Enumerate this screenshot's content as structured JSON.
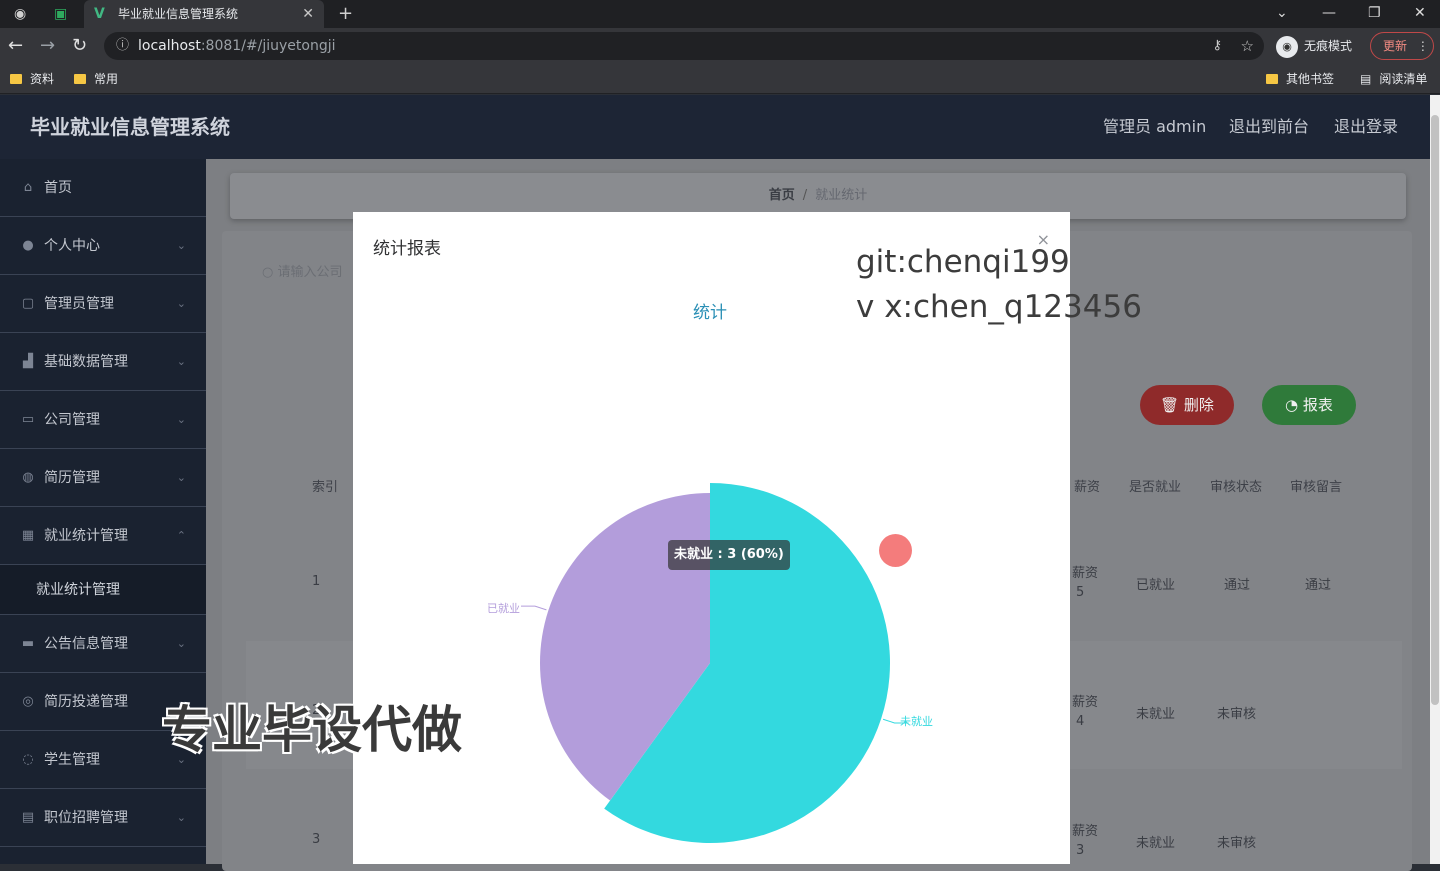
{
  "browser": {
    "tab_title": "毕业就业信息管理系统",
    "url_host": "localhost",
    "url_rest": ":8081/#/jiuyetongji",
    "incognito_label": "无痕模式",
    "update_label": "更新",
    "bookmarks": [
      "资料",
      "常用"
    ],
    "other_bookmarks": "其他书签",
    "reading_list": "阅读清单"
  },
  "app": {
    "brand": "毕业就业信息管理系统",
    "top_links": [
      "管理员 admin",
      "退出到前台",
      "退出登录"
    ]
  },
  "sidebar": {
    "items": [
      {
        "label": "首页",
        "icon": "home-icon"
      },
      {
        "label": "个人中心",
        "icon": "user-icon"
      },
      {
        "label": "管理员管理",
        "icon": "admin-icon"
      },
      {
        "label": "基础数据管理",
        "icon": "data-icon"
      },
      {
        "label": "公司管理",
        "icon": "company-icon"
      },
      {
        "label": "简历管理",
        "icon": "resume-icon"
      },
      {
        "label": "就业统计管理",
        "icon": "stats-icon"
      },
      {
        "label": "公告信息管理",
        "icon": "notice-icon"
      },
      {
        "label": "简历投递管理",
        "icon": "delivery-icon"
      },
      {
        "label": "学生管理",
        "icon": "student-icon"
      },
      {
        "label": "职位招聘管理",
        "icon": "job-icon"
      }
    ],
    "submenu_label": "就业统计管理"
  },
  "breadcrumb": {
    "home": "首页",
    "sep": "/",
    "current": "就业统计"
  },
  "page": {
    "search_hint": "请输入公司",
    "delete_label": "删除",
    "report_label": "报表",
    "headers": [
      "索引",
      "薪资",
      "是否就业",
      "审核状态",
      "审核留言"
    ],
    "rows": [
      {
        "index": "1",
        "salary_a": "薪资",
        "salary_b": "5",
        "employed": "已就业",
        "status": "通过",
        "note": "通过"
      },
      {
        "index": "2",
        "salary_a": "薪资",
        "salary_b": "4",
        "employed": "未就业",
        "status": "未审核",
        "note": ""
      },
      {
        "index": "3",
        "salary_a": "薪资",
        "salary_b": "3",
        "employed": "未就业",
        "status": "未审核",
        "note": ""
      }
    ]
  },
  "dialog": {
    "title": "统计报表",
    "close": "×"
  },
  "chart_data": {
    "type": "pie",
    "title": "统计",
    "slices": [
      {
        "name": "未就业",
        "value": 3,
        "percent": 60,
        "color": "#33d9df"
      },
      {
        "name": "已就业",
        "value": 2,
        "percent": 40,
        "color": "#b39ddb"
      }
    ],
    "tooltip": "未就业 : 3 (60%)"
  },
  "watermarks": {
    "line1": "git:chenqi199",
    "line2": "v x:chen_q123456",
    "big": "专业毕设代做"
  }
}
